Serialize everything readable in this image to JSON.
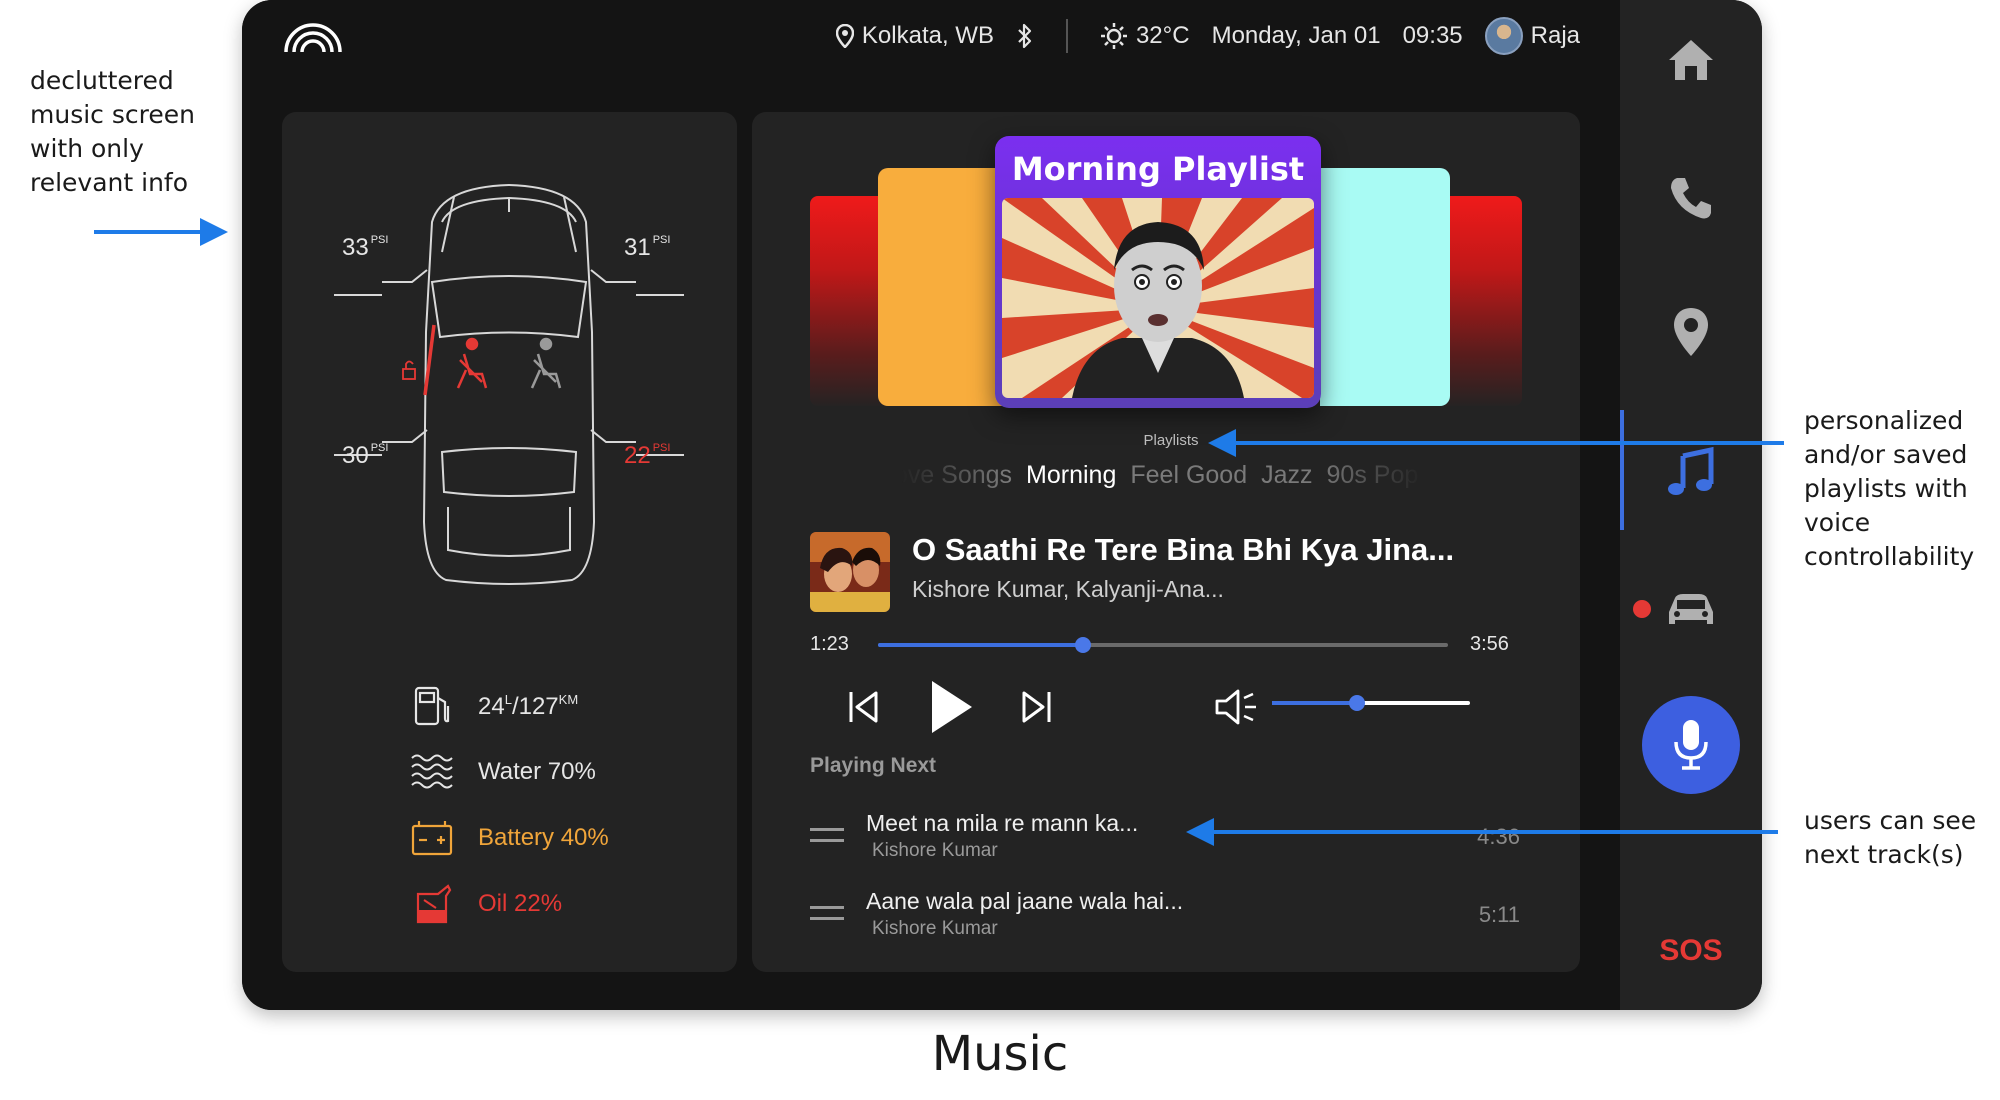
{
  "status": {
    "location": "Kolkata, WB",
    "temperature": "32°C",
    "date": "Monday, Jan 01",
    "time": "09:35",
    "user_name": "Raja"
  },
  "tires": {
    "front_left": "33",
    "front_right": "31",
    "rear_left": "30",
    "rear_right": "22",
    "unit": "PSI"
  },
  "stats": {
    "fuel_liters": "24",
    "fuel_unit": "L",
    "range": "/127",
    "range_unit": "KM",
    "water": "Water 70%",
    "battery": "Battery 40%",
    "oil": "Oil 22%"
  },
  "player": {
    "featured_playlist": "Morning Playlist",
    "playlists_label": "Playlists",
    "playlists": [
      "Love Songs",
      "Morning",
      "Feel Good",
      "Jazz",
      "90s Pop"
    ],
    "active_playlist": "Morning",
    "track_title": "O Saathi Re Tere Bina Bhi Kya Jina...",
    "track_artist": "Kishore Kumar, Kalyanji-Ana...",
    "elapsed": "1:23",
    "duration": "3:56",
    "progress": 0.36,
    "volume": 0.43,
    "playing_next_label": "Playing Next",
    "queue": [
      {
        "title": "Meet na mila re mann ka...",
        "artist": "Kishore Kumar",
        "duration": "4:36"
      },
      {
        "title": "Aane wala pal jaane wala hai...",
        "artist": "Kishore Kumar",
        "duration": "5:11"
      }
    ]
  },
  "sidebar": {
    "items": [
      "home-icon",
      "phone-icon",
      "location-pin-icon",
      "music-note-icon",
      "car-icon"
    ],
    "active": "music-note-icon",
    "sos_label": "SOS"
  },
  "annotations": {
    "left": [
      "decluttered",
      "music screen",
      "with only",
      "relevant info"
    ],
    "right_playlists": [
      "personalized",
      "and/or saved",
      "playlists with",
      "voice",
      "controllability"
    ],
    "right_next": [
      "users can see",
      "next track(s)"
    ],
    "caption": "Music"
  },
  "colors": {
    "accent": "#3d6fe0",
    "warning": "#e53935",
    "battery": "#f0a53a",
    "annotation_arrow": "#1e7be8"
  }
}
